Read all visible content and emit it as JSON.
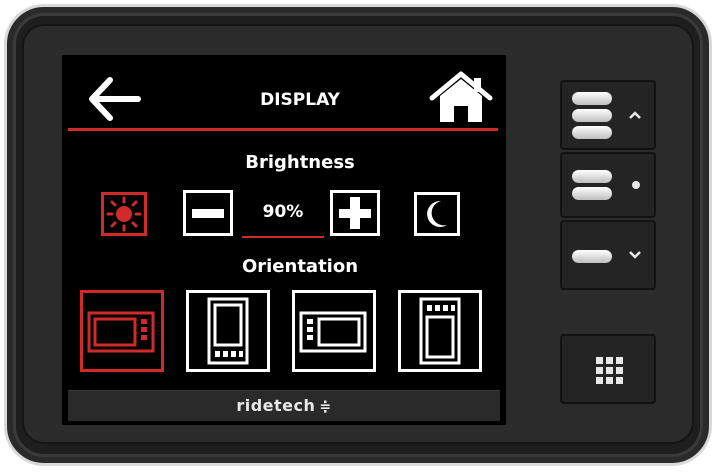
{
  "header": {
    "title": "DISPLAY",
    "back_icon": "arrow-left-icon",
    "home_icon": "home-icon"
  },
  "brightness": {
    "label": "Brightness",
    "value": "90%",
    "day_icon": "sun-icon",
    "decrease_icon": "minus-icon",
    "increase_icon": "plus-icon",
    "night_icon": "moon-icon"
  },
  "orientation": {
    "label": "Orientation",
    "options": [
      {
        "name": "landscape-buttons-right",
        "selected": true
      },
      {
        "name": "portrait-buttons-bottom",
        "selected": false
      },
      {
        "name": "landscape-buttons-left",
        "selected": false
      },
      {
        "name": "portrait-buttons-top",
        "selected": false
      }
    ]
  },
  "footer": {
    "brand": "ridetech"
  },
  "side_buttons": [
    {
      "name": "preset-up-button",
      "icon": "chevron-up-icon"
    },
    {
      "name": "preset-select-button",
      "icon": "dot-icon"
    },
    {
      "name": "preset-down-button",
      "icon": "chevron-down-icon"
    },
    {
      "name": "menu-button",
      "icon": "grid-icon"
    }
  ],
  "colors": {
    "accent": "#d12a2a",
    "screen": "#000000",
    "text": "#ffffff"
  }
}
